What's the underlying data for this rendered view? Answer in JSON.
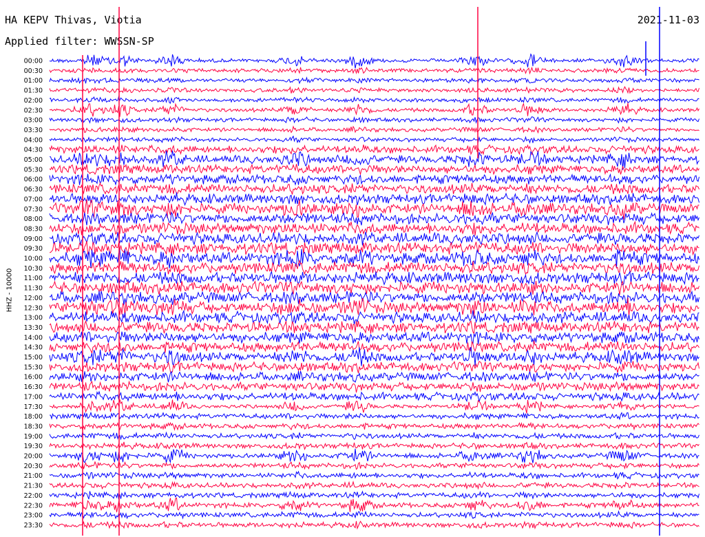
{
  "header": {
    "station_title": "HA KEPV Thivas, Viotia",
    "date": "2021-11-03",
    "filter_text": "Applied filter: WWSSN-SP"
  },
  "chart_data": {
    "type": "line",
    "title": "HA KEPV Thivas, Viotia",
    "subtitle": "Applied filter: WWSSN-SP",
    "date": "2021-11-03",
    "ylabel": "HHZ - 10000",
    "xlabel": "",
    "row_labels": [
      "00:00",
      "00:30",
      "01:00",
      "01:30",
      "02:00",
      "02:30",
      "03:00",
      "03:30",
      "04:00",
      "04:30",
      "05:00",
      "05:30",
      "06:00",
      "06:30",
      "07:00",
      "07:30",
      "08:00",
      "08:30",
      "09:00",
      "09:30",
      "10:00",
      "10:30",
      "11:00",
      "11:30",
      "12:00",
      "12:30",
      "13:00",
      "13:30",
      "14:00",
      "14:30",
      "15:00",
      "15:30",
      "16:00",
      "16:30",
      "17:00",
      "17:30",
      "18:00",
      "18:30",
      "19:00",
      "19:30",
      "20:00",
      "20:30",
      "21:00",
      "21:30",
      "22:00",
      "22:30",
      "23:00",
      "23:30"
    ],
    "row_colors": [
      "#0000ff",
      "#ff0040"
    ],
    "grid": false,
    "legend": "none"
  }
}
